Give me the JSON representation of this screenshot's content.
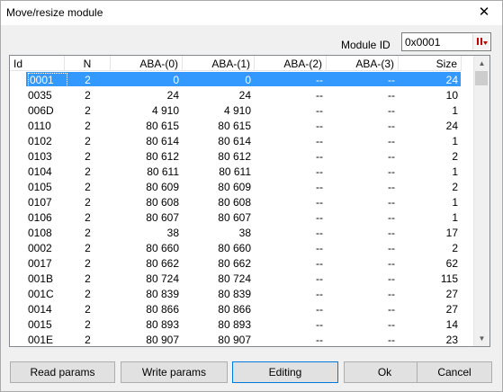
{
  "window": {
    "title": "Move/resize module",
    "close_glyph": "✕"
  },
  "module": {
    "label": "Module ID",
    "value": "0x0001",
    "picker_icon": "sort-icon"
  },
  "table": {
    "headers": [
      "Id",
      "N",
      "ABA-(0)",
      "ABA-(1)",
      "ABA-(2)",
      "ABA-(3)",
      "Size"
    ],
    "selected_row": 0,
    "rows": [
      [
        "0001",
        "2",
        "0",
        "0",
        "--",
        "--",
        "24"
      ],
      [
        "0035",
        "2",
        "24",
        "24",
        "--",
        "--",
        "10"
      ],
      [
        "006D",
        "2",
        "4 910",
        "4 910",
        "--",
        "--",
        "1"
      ],
      [
        "0110",
        "2",
        "80 615",
        "80 615",
        "--",
        "--",
        "24"
      ],
      [
        "0102",
        "2",
        "80 614",
        "80 614",
        "--",
        "--",
        "1"
      ],
      [
        "0103",
        "2",
        "80 612",
        "80 612",
        "--",
        "--",
        "2"
      ],
      [
        "0104",
        "2",
        "80 611",
        "80 611",
        "--",
        "--",
        "1"
      ],
      [
        "0105",
        "2",
        "80 609",
        "80 609",
        "--",
        "--",
        "2"
      ],
      [
        "0107",
        "2",
        "80 608",
        "80 608",
        "--",
        "--",
        "1"
      ],
      [
        "0106",
        "2",
        "80 607",
        "80 607",
        "--",
        "--",
        "1"
      ],
      [
        "0108",
        "2",
        "38",
        "38",
        "--",
        "--",
        "17"
      ],
      [
        "0002",
        "2",
        "80 660",
        "80 660",
        "--",
        "--",
        "2"
      ],
      [
        "0017",
        "2",
        "80 662",
        "80 662",
        "--",
        "--",
        "62"
      ],
      [
        "001B",
        "2",
        "80 724",
        "80 724",
        "--",
        "--",
        "115"
      ],
      [
        "001C",
        "2",
        "80 839",
        "80 839",
        "--",
        "--",
        "27"
      ],
      [
        "0014",
        "2",
        "80 866",
        "80 866",
        "--",
        "--",
        "27"
      ],
      [
        "0015",
        "2",
        "80 893",
        "80 893",
        "--",
        "--",
        "14"
      ],
      [
        "001E",
        "2",
        "80 907",
        "80 907",
        "--",
        "--",
        "23"
      ]
    ]
  },
  "buttons": {
    "read_params": "Read params",
    "write_params": "Write params",
    "editing": "Editing",
    "ok": "Ok",
    "cancel": "Cancel"
  }
}
